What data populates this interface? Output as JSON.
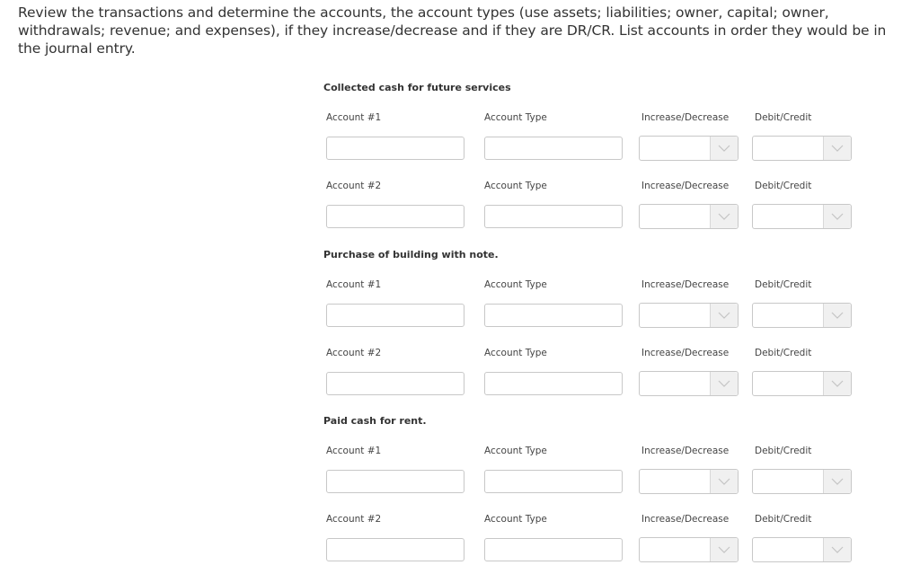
{
  "instructions": "Review the transactions and determine the accounts, the account types (use assets; liabilities; owner, capital; owner, withdrawals; revenue; and expenses), if they increase/decrease and if they are DR/CR. List accounts in order they would be in the journal entry.",
  "columns": {
    "account_type": "Account Type",
    "increase_decrease": "Increase/Decrease",
    "debit_credit": "Debit/Credit"
  },
  "transactions": [
    {
      "title": "Collected cash for future services",
      "rows": [
        {
          "account_label": "Account #1",
          "account_value": "",
          "account_type_value": "",
          "increase_decrease_value": "",
          "debit_credit_value": ""
        },
        {
          "account_label": "Account #2",
          "account_value": "",
          "account_type_value": "",
          "increase_decrease_value": "",
          "debit_credit_value": ""
        }
      ]
    },
    {
      "title": "Purchase of building with note.",
      "rows": [
        {
          "account_label": "Account #1",
          "account_value": "",
          "account_type_value": "",
          "increase_decrease_value": "",
          "debit_credit_value": ""
        },
        {
          "account_label": "Account #2",
          "account_value": "",
          "account_type_value": "",
          "increase_decrease_value": "",
          "debit_credit_value": ""
        }
      ]
    },
    {
      "title": "Paid cash for rent.",
      "rows": [
        {
          "account_label": "Account #1",
          "account_value": "",
          "account_type_value": "",
          "increase_decrease_value": "",
          "debit_credit_value": ""
        },
        {
          "account_label": "Account #2",
          "account_value": "",
          "account_type_value": "",
          "increase_decrease_value": "",
          "debit_credit_value": ""
        }
      ]
    }
  ],
  "icons": {
    "dropdown": "chevron-down-icon"
  }
}
